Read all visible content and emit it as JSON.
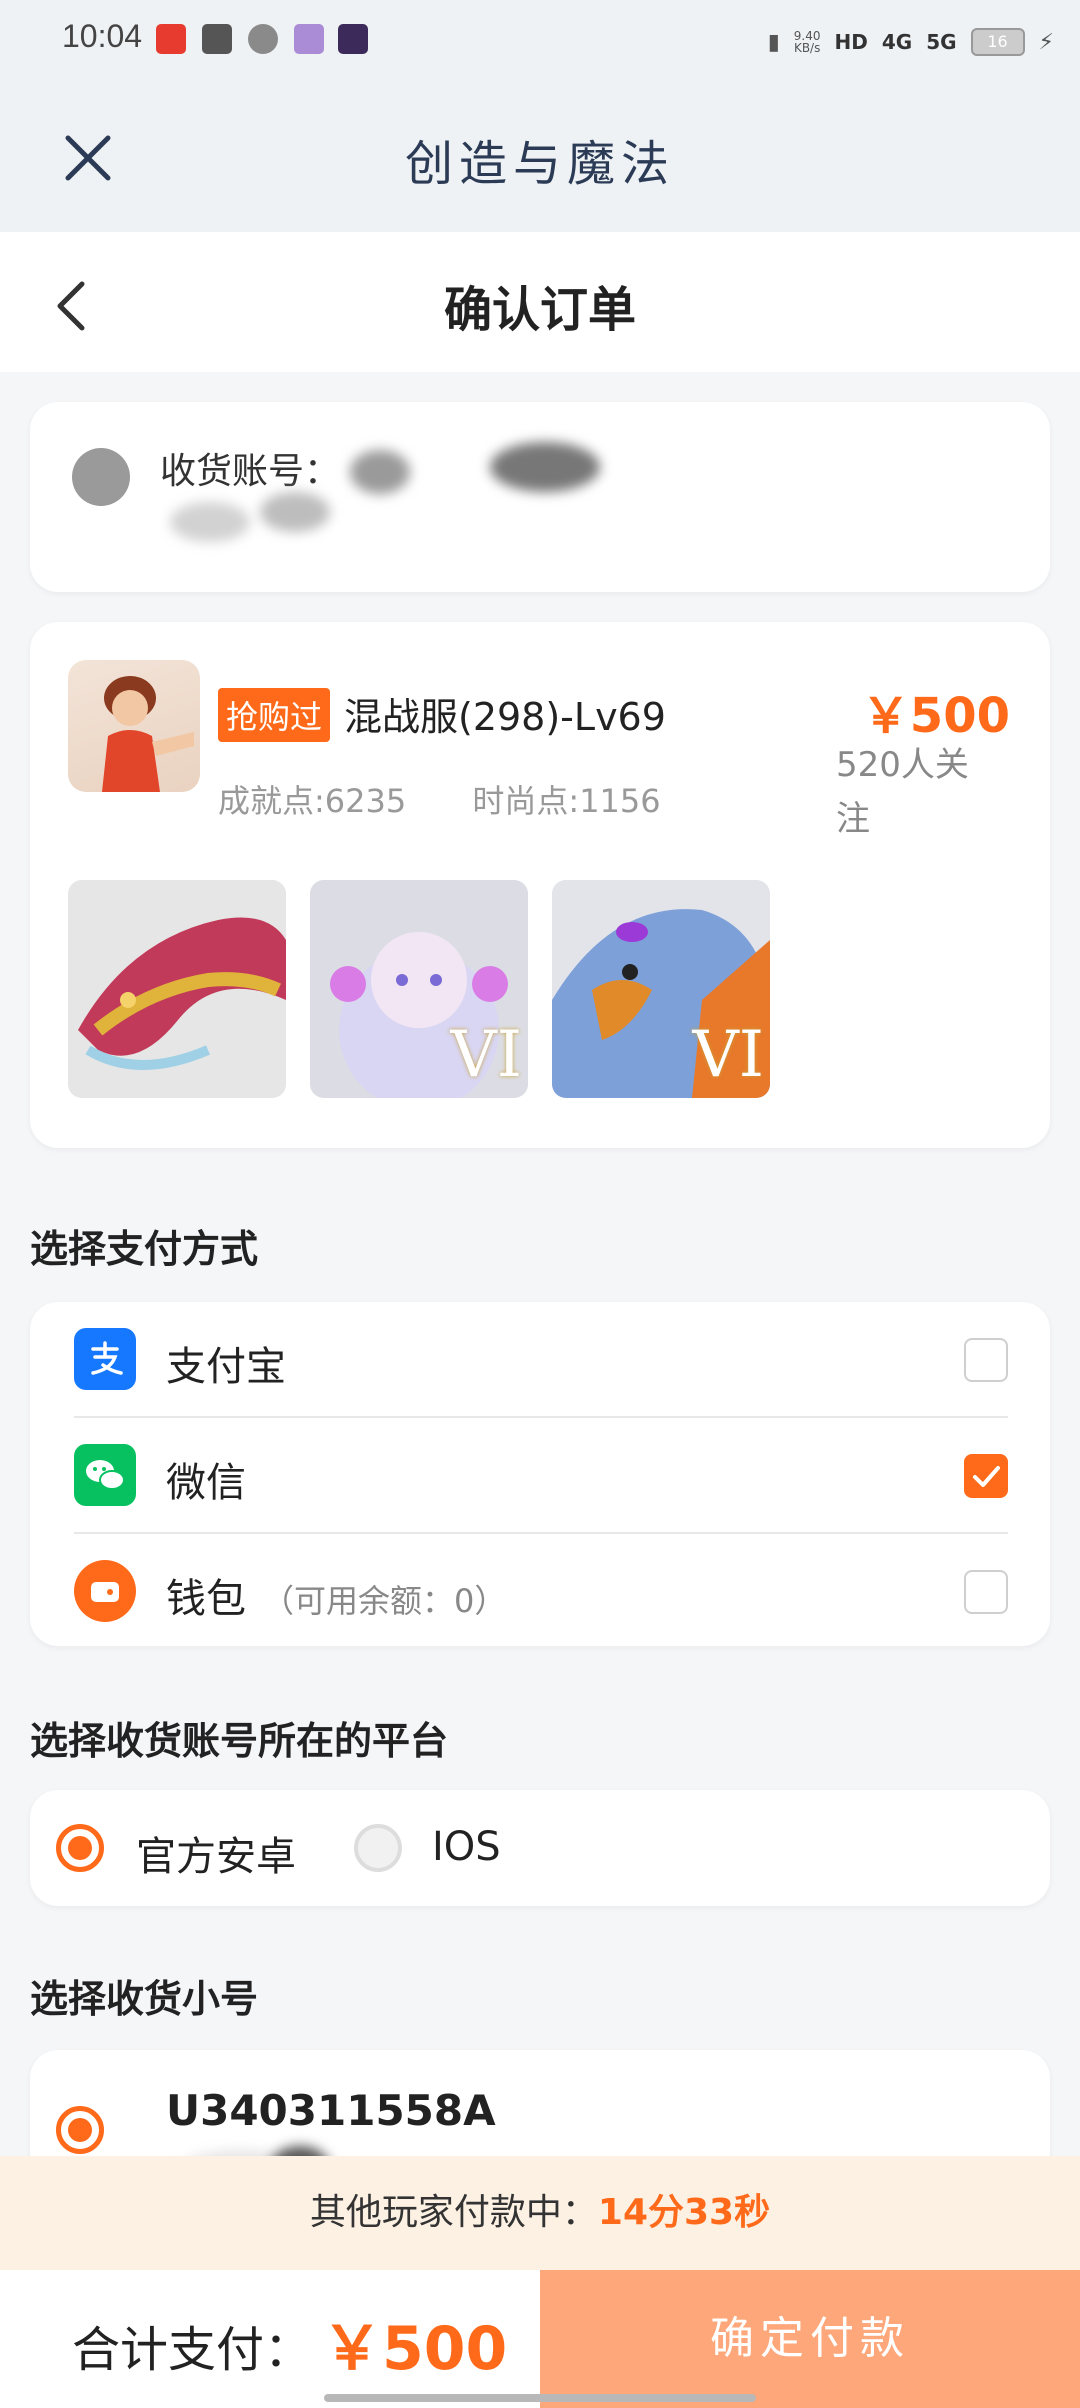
{
  "status_bar": {
    "time": "10:04",
    "net_speed_top": "9.40",
    "net_speed_bottom": "KB/s",
    "hd": "HD",
    "net1": "4G",
    "net2": "5G",
    "battery": "16"
  },
  "app_bar": {
    "title": "创造与魔法"
  },
  "header": {
    "title": "确认订单"
  },
  "account": {
    "label": "收货账号："
  },
  "product": {
    "badge": "抢购过",
    "name": "混战服(298)-Lv69",
    "price": "￥500",
    "followers": "520人关注",
    "achievement": "成就点:6235",
    "fashion": "时尚点:1156",
    "thumb_marks": [
      "VI",
      "VI"
    ]
  },
  "payment": {
    "section_title": "选择支付方式",
    "options": [
      {
        "label": "支付宝",
        "sub": "",
        "icon": "alipay-icon",
        "checked": false
      },
      {
        "label": "微信",
        "sub": "",
        "icon": "wechat-icon",
        "checked": true
      },
      {
        "label": "钱包",
        "sub": "（可用余额：0）",
        "icon": "wallet-icon",
        "checked": false
      }
    ]
  },
  "platform": {
    "section_title": "选择收货账号所在的平台",
    "options": [
      {
        "label": "官方安卓",
        "selected": true
      },
      {
        "label": "IOS",
        "selected": false
      }
    ]
  },
  "sub_account": {
    "section_title": "选择收货小号",
    "id": "U340311558A"
  },
  "timer": {
    "prefix": "其他玩家付款中：",
    "value": "14分33秒"
  },
  "footer": {
    "total_label": "合计支付：",
    "total_value": "￥500",
    "pay_button": "确定付款"
  },
  "colors": {
    "accent": "#ff6a1a",
    "alipay": "#1677ff",
    "wechat": "#07c160"
  }
}
